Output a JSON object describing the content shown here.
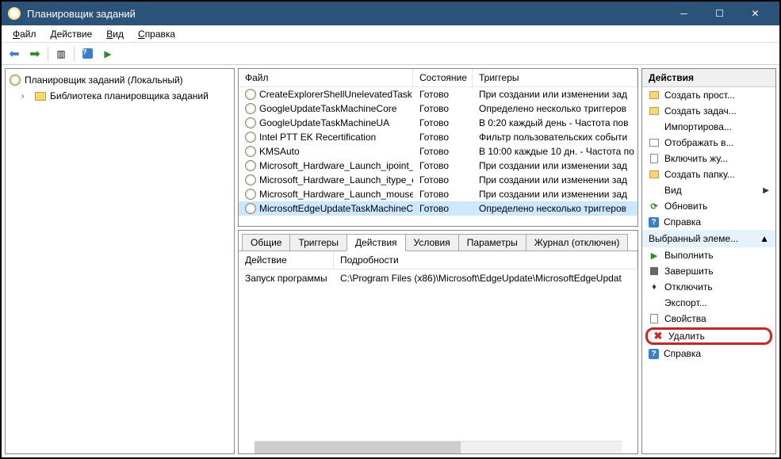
{
  "titlebar": {
    "title": "Планировщик заданий"
  },
  "menubar": {
    "file": "Файл",
    "action": "Действие",
    "view": "Вид",
    "help": "Справка"
  },
  "tree": {
    "root": "Планировщик заданий (Локальный)",
    "library": "Библиотека планировщика заданий"
  },
  "task_list": {
    "headers": {
      "file": "Файл",
      "status": "Состояние",
      "triggers": "Триггеры"
    },
    "rows": [
      {
        "name": "CreateExplorerShellUnelevatedTask",
        "status": "Готово",
        "trigger": "При создании или изменении зад"
      },
      {
        "name": "GoogleUpdateTaskMachineCore",
        "status": "Готово",
        "trigger": "Определено несколько триггеров"
      },
      {
        "name": "GoogleUpdateTaskMachineUA",
        "status": "Готово",
        "trigger": "В 0:20 каждый день - Частота пов"
      },
      {
        "name": "Intel PTT EK Recertification",
        "status": "Готово",
        "trigger": "Фильтр пользовательских событи"
      },
      {
        "name": "KMSAuto",
        "status": "Готово",
        "trigger": "В 10:00 каждые 10 дн. - Частота по"
      },
      {
        "name": "Microsoft_Hardware_Launch_ipoint_...",
        "status": "Готово",
        "trigger": "При создании или изменении зад"
      },
      {
        "name": "Microsoft_Hardware_Launch_itype_exe",
        "status": "Готово",
        "trigger": "При создании или изменении зад"
      },
      {
        "name": "Microsoft_Hardware_Launch_mouse...",
        "status": "Готово",
        "trigger": "При создании или изменении зад"
      },
      {
        "name": "MicrosoftEdgeUpdateTaskMachineC...",
        "status": "Готово",
        "trigger": "Определено несколько триггеров"
      }
    ]
  },
  "detail": {
    "tabs": {
      "general": "Общие",
      "triggers": "Триггеры",
      "actions": "Действия",
      "conditions": "Условия",
      "settings": "Параметры",
      "history": "Журнал (отключен)"
    },
    "headers": {
      "action": "Действие",
      "details": "Подробности"
    },
    "row": {
      "action": "Запуск программы",
      "details": "C:\\Program Files (x86)\\Microsoft\\EdgeUpdate\\MicrosoftEdgeUpdat"
    }
  },
  "actions": {
    "header": "Действия",
    "items": {
      "create_basic": "Создать прост...",
      "create_task": "Создать задач...",
      "import": "Импортирова...",
      "display_all": "Отображать в...",
      "enable_history": "Включить жу...",
      "new_folder": "Создать папку...",
      "view": "Вид",
      "refresh": "Обновить",
      "help1": "Справка",
      "selected_section": "Выбранный элеме...",
      "run": "Выполнить",
      "end": "Завершить",
      "disable": "Отключить",
      "export": "Экспорт...",
      "properties": "Свойства",
      "delete": "Удалить",
      "help2": "Справка"
    }
  }
}
